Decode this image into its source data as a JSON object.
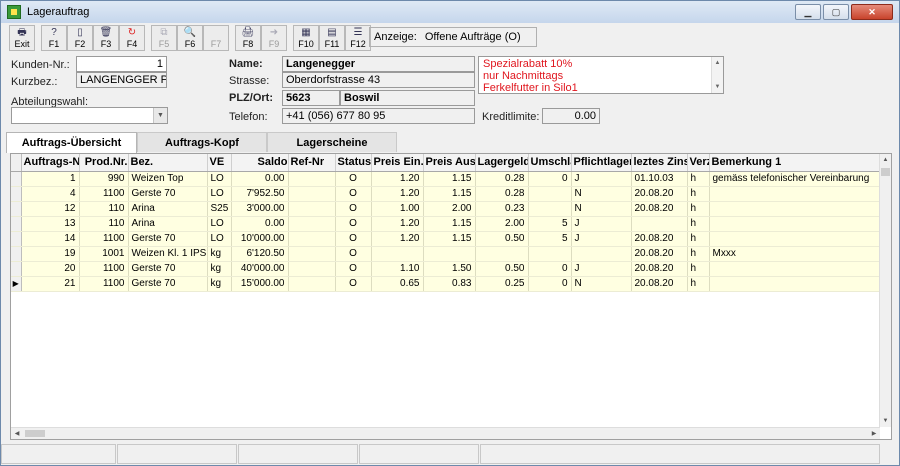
{
  "window": {
    "title": "Lagerauftrag"
  },
  "toolbar": {
    "buttons": [
      {
        "label": "Exit",
        "icon": "printer-exit-icon",
        "enabled": true
      },
      {
        "label": "F1",
        "icon": "help-icon",
        "enabled": true
      },
      {
        "label": "F2",
        "icon": "new-document-icon",
        "enabled": true
      },
      {
        "label": "F3",
        "icon": "trash-icon",
        "enabled": true
      },
      {
        "label": "F4",
        "icon": "refresh-icon",
        "enabled": true
      },
      {
        "label": "F5",
        "icon": "copy-icon",
        "enabled": false
      },
      {
        "label": "F6",
        "icon": "search-icon",
        "enabled": true
      },
      {
        "label": "F7",
        "icon": "blank-icon",
        "enabled": false
      },
      {
        "label": "F8",
        "icon": "print-icon",
        "enabled": true
      },
      {
        "label": "F9",
        "icon": "forward-icon",
        "enabled": false
      },
      {
        "label": "F10",
        "icon": "calculator-icon",
        "enabled": true
      },
      {
        "label": "F11",
        "icon": "calendar-icon",
        "enabled": true
      },
      {
        "label": "F12",
        "icon": "list-icon",
        "enabled": true
      }
    ]
  },
  "anzeige": {
    "label": "Anzeige:",
    "value": "Offene Aufträge (O)"
  },
  "customer": {
    "kunden_nr_label": "Kunden-Nr.:",
    "kunden_nr": "1",
    "kurzbez_label": "Kurzbez.:",
    "kurzbez": "LANGENGGER PAUL",
    "abteilung_label": "Abteilungswahl:",
    "abteilung_value": ""
  },
  "address": {
    "name_label": "Name:",
    "name": "Langenegger",
    "strasse_label": "Strasse:",
    "strasse": "Oberdorfstrasse 43",
    "plz_label": "PLZ/Ort:",
    "plz": "5623",
    "ort": "Boswil",
    "telefon_label": "Telefon:",
    "telefon": "+41 (056) 677 80 95"
  },
  "notes": {
    "lines": [
      "Spezialrabatt 10%",
      "nur Nachmittags",
      "Ferkelfutter in Silo1"
    ],
    "color": "#e0161e"
  },
  "kredit": {
    "label": "Kreditlimite:",
    "value": "0.00"
  },
  "tabs": [
    {
      "label": "Auftrags-Übersicht",
      "active": true
    },
    {
      "label": "Auftrags-Kopf",
      "active": false
    },
    {
      "label": "Lagerscheine",
      "active": false
    }
  ],
  "grid": {
    "columns": [
      "Auftrags-Nr",
      "Prod.Nr.",
      "Bez.",
      "VE",
      "Saldo",
      "Ref-Nr",
      "Status",
      "Preis Ein.",
      "Preis Aus.",
      "Lagergeld",
      "Umschlag",
      "Pflichtlager",
      "leztes Zins",
      "Verz",
      "Bemerkung 1"
    ],
    "rows": [
      [
        "1",
        "990",
        "Weizen Top",
        "LO",
        "0.00",
        "",
        "O",
        "1.20",
        "1.15",
        "0.28",
        "0",
        "J",
        "01.10.03",
        "h",
        "gemäss telefonischer Vereinbarung"
      ],
      [
        "4",
        "1100",
        "Gerste 70",
        "LO",
        "7'952.50",
        "",
        "O",
        "1.20",
        "1.15",
        "0.28",
        "",
        "N",
        "20.08.20",
        "h",
        ""
      ],
      [
        "12",
        "110",
        "Arina",
        "S25",
        "3'000.00",
        "",
        "O",
        "1.00",
        "2.00",
        "0.23",
        "",
        "N",
        "20.08.20",
        "h",
        ""
      ],
      [
        "13",
        "110",
        "Arina",
        "LO",
        "0.00",
        "",
        "O",
        "1.20",
        "1.15",
        "2.00",
        "5",
        "J",
        "",
        "h",
        ""
      ],
      [
        "14",
        "1100",
        "Gerste 70",
        "LO",
        "10'000.00",
        "",
        "O",
        "1.20",
        "1.15",
        "0.50",
        "5",
        "J",
        "20.08.20",
        "h",
        ""
      ],
      [
        "19",
        "1001",
        "Weizen Kl. 1 IPS",
        "kg",
        "6'120.50",
        "",
        "O",
        "",
        "",
        "",
        "",
        "",
        "20.08.20",
        "h",
        "Mxxx"
      ],
      [
        "20",
        "1100",
        "Gerste 70",
        "kg",
        "40'000.00",
        "",
        "O",
        "1.10",
        "1.50",
        "0.50",
        "0",
        "J",
        "20.08.20",
        "h",
        ""
      ],
      [
        "21",
        "1100",
        "Gerste 70",
        "kg",
        "15'000.00",
        "",
        "O",
        "0.65",
        "0.83",
        "0.25",
        "0",
        "N",
        "20.08.20",
        "h",
        ""
      ]
    ],
    "current_row": 7,
    "row_color": "#ffffe1"
  }
}
